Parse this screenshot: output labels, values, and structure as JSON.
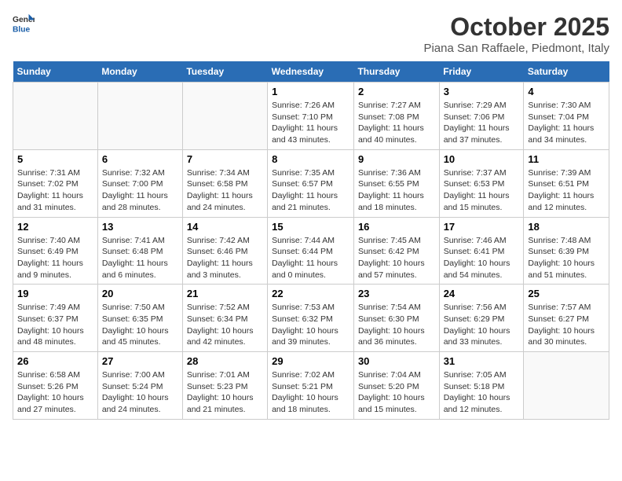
{
  "header": {
    "logo": {
      "general": "General",
      "blue": "Blue"
    },
    "title": "October 2025",
    "subtitle": "Piana San Raffaele, Piedmont, Italy"
  },
  "weekdays": [
    "Sunday",
    "Monday",
    "Tuesday",
    "Wednesday",
    "Thursday",
    "Friday",
    "Saturday"
  ],
  "weeks": [
    [
      {
        "day": "",
        "info": ""
      },
      {
        "day": "",
        "info": ""
      },
      {
        "day": "",
        "info": ""
      },
      {
        "day": "1",
        "info": "Sunrise: 7:26 AM\nSunset: 7:10 PM\nDaylight: 11 hours and 43 minutes."
      },
      {
        "day": "2",
        "info": "Sunrise: 7:27 AM\nSunset: 7:08 PM\nDaylight: 11 hours and 40 minutes."
      },
      {
        "day": "3",
        "info": "Sunrise: 7:29 AM\nSunset: 7:06 PM\nDaylight: 11 hours and 37 minutes."
      },
      {
        "day": "4",
        "info": "Sunrise: 7:30 AM\nSunset: 7:04 PM\nDaylight: 11 hours and 34 minutes."
      }
    ],
    [
      {
        "day": "5",
        "info": "Sunrise: 7:31 AM\nSunset: 7:02 PM\nDaylight: 11 hours and 31 minutes."
      },
      {
        "day": "6",
        "info": "Sunrise: 7:32 AM\nSunset: 7:00 PM\nDaylight: 11 hours and 28 minutes."
      },
      {
        "day": "7",
        "info": "Sunrise: 7:34 AM\nSunset: 6:58 PM\nDaylight: 11 hours and 24 minutes."
      },
      {
        "day": "8",
        "info": "Sunrise: 7:35 AM\nSunset: 6:57 PM\nDaylight: 11 hours and 21 minutes."
      },
      {
        "day": "9",
        "info": "Sunrise: 7:36 AM\nSunset: 6:55 PM\nDaylight: 11 hours and 18 minutes."
      },
      {
        "day": "10",
        "info": "Sunrise: 7:37 AM\nSunset: 6:53 PM\nDaylight: 11 hours and 15 minutes."
      },
      {
        "day": "11",
        "info": "Sunrise: 7:39 AM\nSunset: 6:51 PM\nDaylight: 11 hours and 12 minutes."
      }
    ],
    [
      {
        "day": "12",
        "info": "Sunrise: 7:40 AM\nSunset: 6:49 PM\nDaylight: 11 hours and 9 minutes."
      },
      {
        "day": "13",
        "info": "Sunrise: 7:41 AM\nSunset: 6:48 PM\nDaylight: 11 hours and 6 minutes."
      },
      {
        "day": "14",
        "info": "Sunrise: 7:42 AM\nSunset: 6:46 PM\nDaylight: 11 hours and 3 minutes."
      },
      {
        "day": "15",
        "info": "Sunrise: 7:44 AM\nSunset: 6:44 PM\nDaylight: 11 hours and 0 minutes."
      },
      {
        "day": "16",
        "info": "Sunrise: 7:45 AM\nSunset: 6:42 PM\nDaylight: 10 hours and 57 minutes."
      },
      {
        "day": "17",
        "info": "Sunrise: 7:46 AM\nSunset: 6:41 PM\nDaylight: 10 hours and 54 minutes."
      },
      {
        "day": "18",
        "info": "Sunrise: 7:48 AM\nSunset: 6:39 PM\nDaylight: 10 hours and 51 minutes."
      }
    ],
    [
      {
        "day": "19",
        "info": "Sunrise: 7:49 AM\nSunset: 6:37 PM\nDaylight: 10 hours and 48 minutes."
      },
      {
        "day": "20",
        "info": "Sunrise: 7:50 AM\nSunset: 6:35 PM\nDaylight: 10 hours and 45 minutes."
      },
      {
        "day": "21",
        "info": "Sunrise: 7:52 AM\nSunset: 6:34 PM\nDaylight: 10 hours and 42 minutes."
      },
      {
        "day": "22",
        "info": "Sunrise: 7:53 AM\nSunset: 6:32 PM\nDaylight: 10 hours and 39 minutes."
      },
      {
        "day": "23",
        "info": "Sunrise: 7:54 AM\nSunset: 6:30 PM\nDaylight: 10 hours and 36 minutes."
      },
      {
        "day": "24",
        "info": "Sunrise: 7:56 AM\nSunset: 6:29 PM\nDaylight: 10 hours and 33 minutes."
      },
      {
        "day": "25",
        "info": "Sunrise: 7:57 AM\nSunset: 6:27 PM\nDaylight: 10 hours and 30 minutes."
      }
    ],
    [
      {
        "day": "26",
        "info": "Sunrise: 6:58 AM\nSunset: 5:26 PM\nDaylight: 10 hours and 27 minutes."
      },
      {
        "day": "27",
        "info": "Sunrise: 7:00 AM\nSunset: 5:24 PM\nDaylight: 10 hours and 24 minutes."
      },
      {
        "day": "28",
        "info": "Sunrise: 7:01 AM\nSunset: 5:23 PM\nDaylight: 10 hours and 21 minutes."
      },
      {
        "day": "29",
        "info": "Sunrise: 7:02 AM\nSunset: 5:21 PM\nDaylight: 10 hours and 18 minutes."
      },
      {
        "day": "30",
        "info": "Sunrise: 7:04 AM\nSunset: 5:20 PM\nDaylight: 10 hours and 15 minutes."
      },
      {
        "day": "31",
        "info": "Sunrise: 7:05 AM\nSunset: 5:18 PM\nDaylight: 10 hours and 12 minutes."
      },
      {
        "day": "",
        "info": ""
      }
    ]
  ]
}
